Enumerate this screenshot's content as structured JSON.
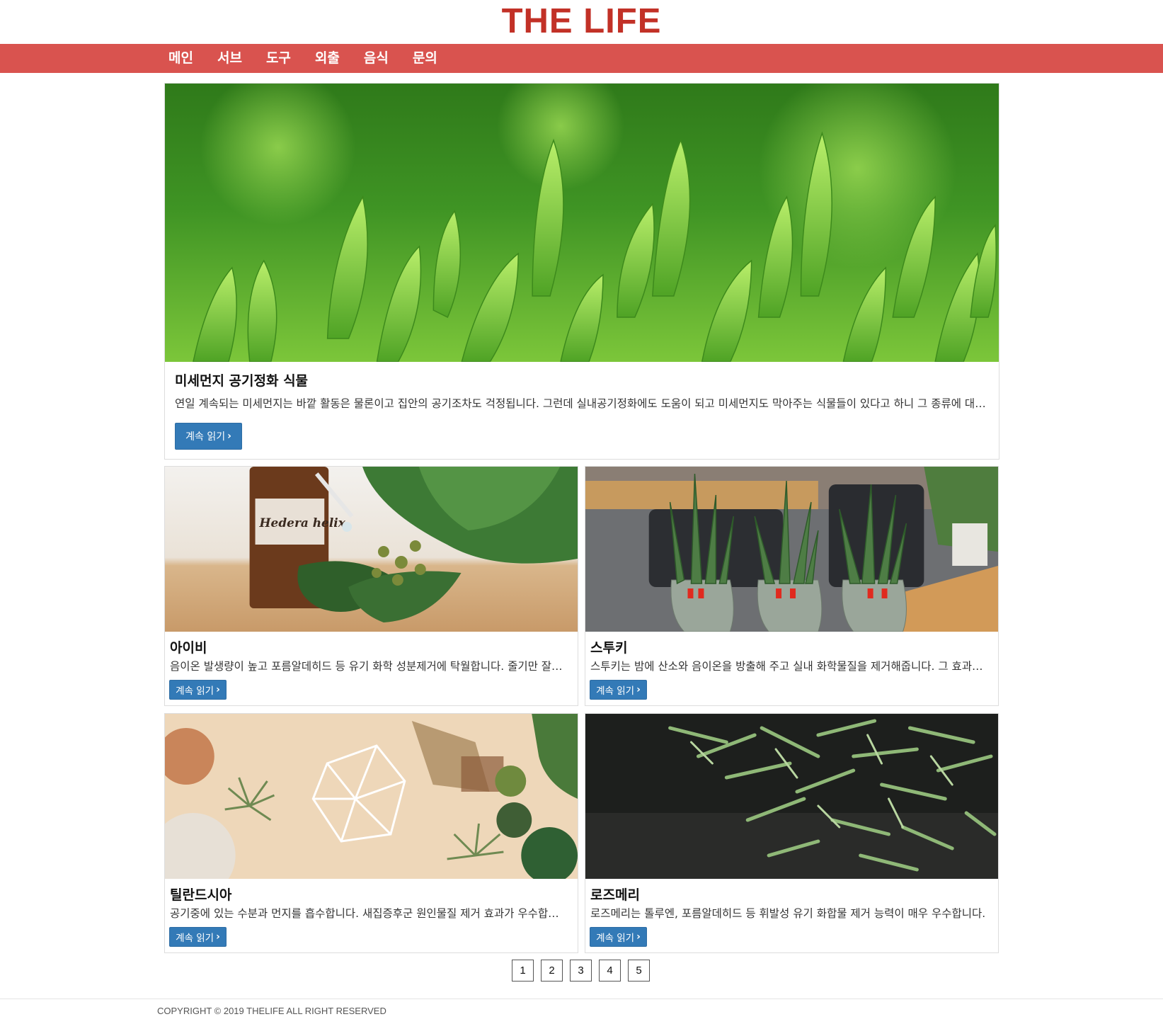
{
  "site": {
    "title": "THE LIFE"
  },
  "nav": {
    "items": [
      "메인",
      "서브",
      "도구",
      "외출",
      "음식",
      "문의"
    ]
  },
  "hero": {
    "image": "tea-plant-leaves",
    "title": "미세먼지 공기정화 식물",
    "text": "연일 계속되는 미세먼지는 바깥 활동은 물론이고 집안의 공기조차도 걱정됩니다. 그런데 실내공기정화에도 도움이 되고 미세먼지도 막아주는 식물들이 있다고 하니 그 종류에 대해 알아보도록 하겠습니다.",
    "button": "계속 읽기"
  },
  "cards": [
    {
      "image": "ivy-dropper-bottle",
      "title": "아이비",
      "text": "음이온 발생량이 높고 포름알데히드 등 유기 화학 성분제거에 탁월합니다. 줄기만 잘라서 물에 꽂아두어도 잘 자랍니다.",
      "button": "계속 읽기"
    },
    {
      "image": "stuckyi-pots",
      "title": "스투키",
      "text": "스투키는 밤에 산소와 음이온을 방출해 주고 실내 화학물질을 제거해줍니다. 그 효과가 매우 뛰어납니다.",
      "button": "계속 읽기"
    },
    {
      "image": "tillandsia-table",
      "title": "틸란드시아",
      "text": "공기중에 있는 수분과 먼지를 흡수합니다. 새집증후군 원인물질 제거 효과가 우수합니다.",
      "button": "계속 읽기"
    },
    {
      "image": "rosemary-plant",
      "title": "로즈메리",
      "text": "로즈메리는 톨루엔, 포름알데히드 등 휘발성 유기 화합물 제거 능력이 매우 우수합니다.",
      "button": "계속 읽기"
    }
  ],
  "pagination": {
    "pages": [
      "1",
      "2",
      "3",
      "4",
      "5"
    ]
  },
  "footer": {
    "copyright": "COPYRIGHT © 2019 THELIFE ALL RIGHT RESERVED"
  },
  "colors": {
    "brand": "#c23127",
    "nav_bg": "#d9534f",
    "button": "#337ab7"
  }
}
